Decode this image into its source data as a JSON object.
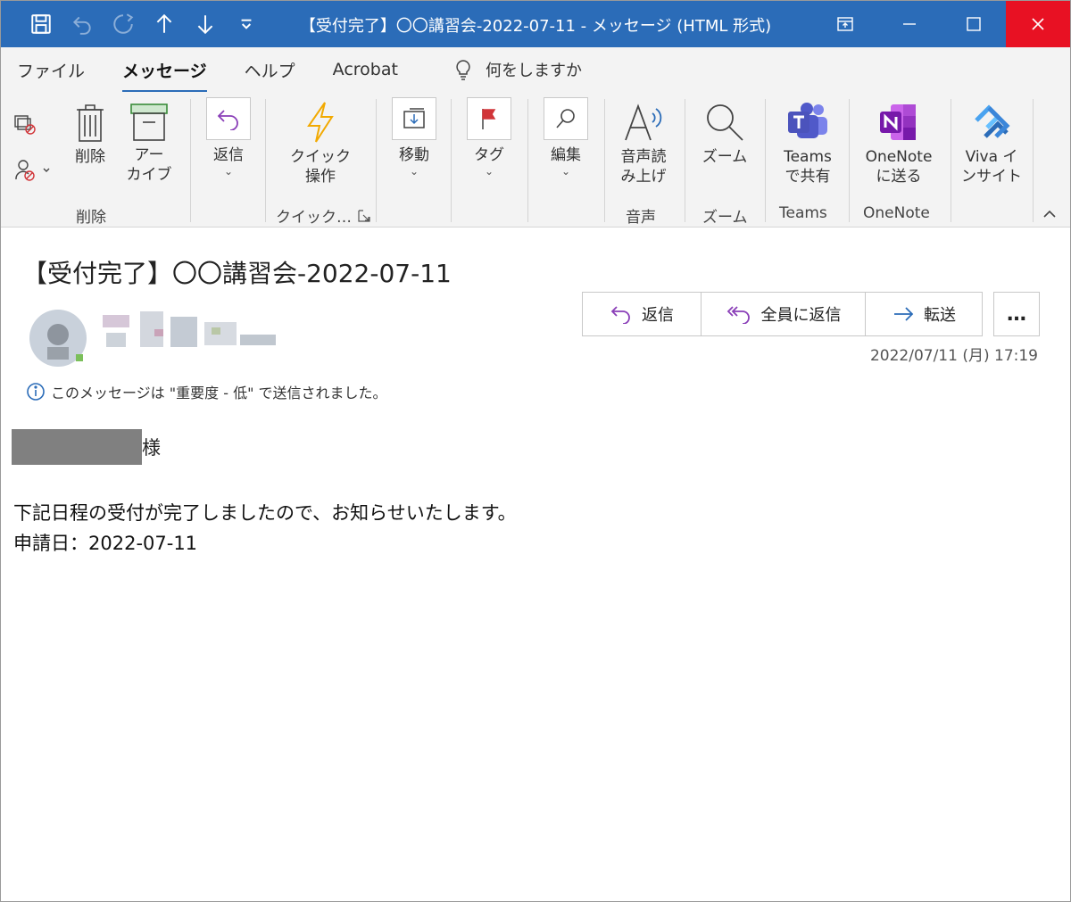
{
  "window": {
    "title": "【受付完了】〇〇講習会-2022-07-11  -  メッセージ (HTML 形式)"
  },
  "tabs": [
    {
      "label": "ファイル",
      "active": false
    },
    {
      "label": "メッセージ",
      "active": true
    },
    {
      "label": "ヘルプ",
      "active": false
    },
    {
      "label": "Acrobat",
      "active": false
    }
  ],
  "tell_me": "何をしますか",
  "ribbon": {
    "delete_label": "削除",
    "archive_label": "アー\nカイブ",
    "group_delete": "削除",
    "reply_label": "返信",
    "quick_label_1": "クイック",
    "quick_label_2": "操作",
    "group_quick": "クイック…",
    "move_label": "移動",
    "tag_label": "タグ",
    "edit_label": "編集",
    "read_aloud_1": "音声読",
    "read_aloud_2": "み上げ",
    "group_voice": "音声",
    "zoom_label": "ズーム",
    "group_zoom": "ズーム",
    "teams_1": "Teams",
    "teams_2": "で共有",
    "group_teams": "Teams",
    "onenote_1": "OneNote",
    "onenote_2": "に送る",
    "group_onenote": "OneNote",
    "viva_1": "Viva イ",
    "viva_2": "ンサイト"
  },
  "message": {
    "subject": "【受付完了】〇〇講習会-2022-07-11",
    "reply": "返信",
    "reply_all": "全員に返信",
    "forward": "転送",
    "more": "…",
    "date": "2022/07/11 (月) 17:19",
    "importance": "このメッセージは \"重要度 - 低\" で送信されました。"
  },
  "body": {
    "honorific": "様",
    "line1": "下記日程の受付が完了しましたので、お知らせいたします。",
    "line2": "申請日：2022-07-11"
  },
  "colors": {
    "titlebar": "#2b6cb8",
    "close": "#e81123",
    "accent_purple": "#8a3fb8",
    "flag_red": "#d13438",
    "quick_yellow": "#f2a900"
  }
}
